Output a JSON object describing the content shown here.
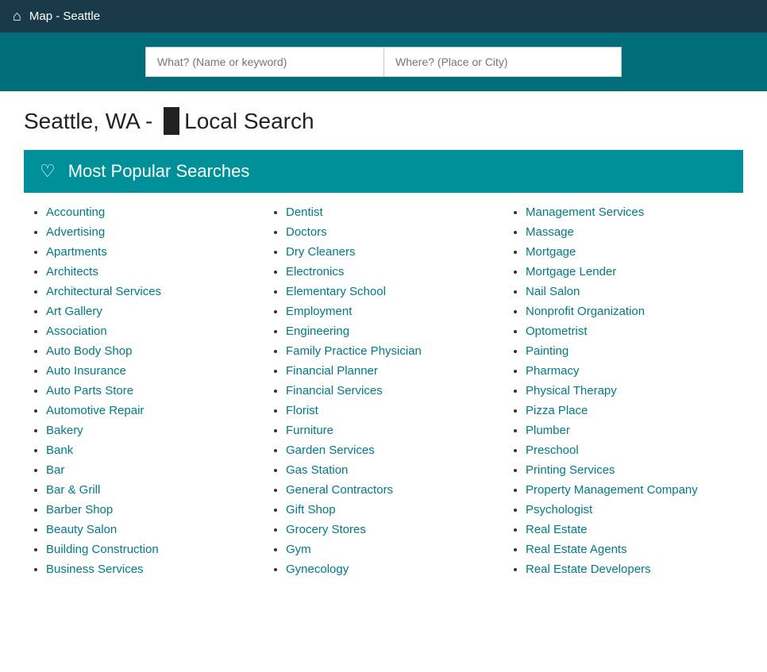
{
  "nav": {
    "home_icon": "⌂",
    "title": "Map - Seattle"
  },
  "search": {
    "what_placeholder": "What? (Name or keyword)",
    "where_placeholder": "Where? (Place or City)"
  },
  "page_title": {
    "prefix": "Seattle, WA -",
    "highlight": "       ",
    "suffix": "Local Search"
  },
  "popular": {
    "icon": "♡",
    "title": "Most Popular Searches"
  },
  "columns": [
    {
      "items": [
        "Accounting",
        "Advertising",
        "Apartments",
        "Architects",
        "Architectural Services",
        "Art Gallery",
        "Association",
        "Auto Body Shop",
        "Auto Insurance",
        "Auto Parts Store",
        "Automotive Repair",
        "Bakery",
        "Bank",
        "Bar",
        "Bar & Grill",
        "Barber Shop",
        "Beauty Salon",
        "Building Construction",
        "Business Services"
      ]
    },
    {
      "items": [
        "Dentist",
        "Doctors",
        "Dry Cleaners",
        "Electronics",
        "Elementary School",
        "Employment",
        "Engineering",
        "Family Practice Physician",
        "Financial Planner",
        "Financial Services",
        "Florist",
        "Furniture",
        "Garden Services",
        "Gas Station",
        "General Contractors",
        "Gift Shop",
        "Grocery Stores",
        "Gym",
        "Gynecology"
      ]
    },
    {
      "items": [
        "Management Services",
        "Massage",
        "Mortgage",
        "Mortgage Lender",
        "Nail Salon",
        "Nonprofit Organization",
        "Optometrist",
        "Painting",
        "Pharmacy",
        "Physical Therapy",
        "Pizza Place",
        "Plumber",
        "Preschool",
        "Printing Services",
        "Property Management Company",
        "Psychologist",
        "Real Estate",
        "Real Estate Agents",
        "Real Estate Developers"
      ]
    }
  ]
}
